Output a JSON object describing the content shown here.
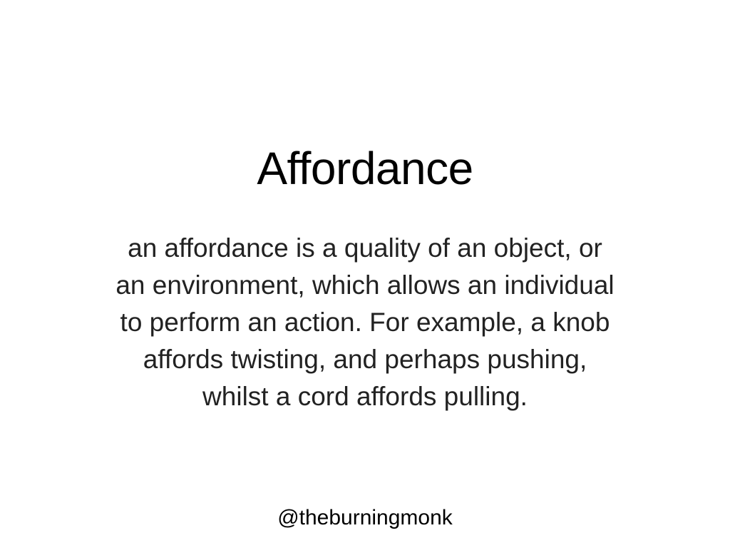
{
  "slide": {
    "title": "Affordance",
    "body_lines": [
      "an affordance is a quality of an object, or",
      "an environment, which allows an individual",
      "to perform an action. For example, a knob",
      "affords twisting, and perhaps pushing,",
      "whilst a cord affords pulling."
    ],
    "footer": "@theburningmonk"
  },
  "colors": {
    "background": "#ffffff",
    "title_text": "#000000",
    "body_text": "#222222"
  }
}
